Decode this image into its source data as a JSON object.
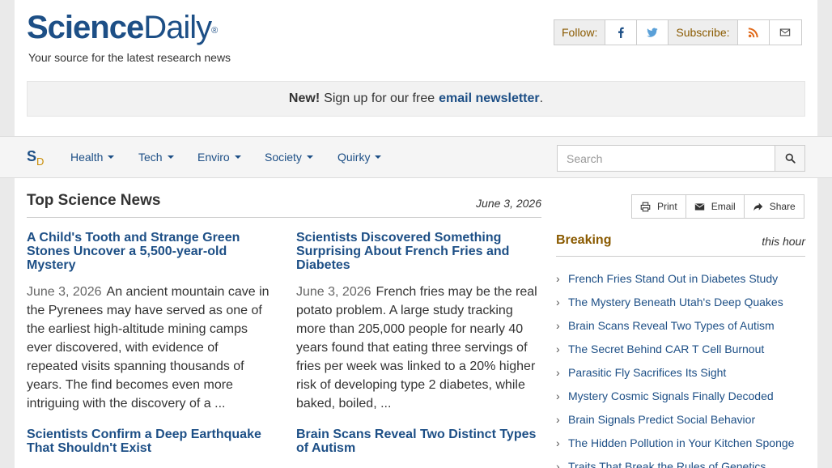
{
  "header": {
    "logo_bold": "Science",
    "logo_light": "Daily",
    "logo_mark": "®",
    "tagline": "Your source for the latest research news",
    "follow_label": "Follow:",
    "subscribe_label": "Subscribe:"
  },
  "newsletter": {
    "new_label": "New!",
    "text": "Sign up for our free",
    "link": "email newsletter",
    "end": "."
  },
  "nav": {
    "logo_s": "S",
    "logo_d": "D",
    "items": [
      "Health",
      "Tech",
      "Enviro",
      "Society",
      "Quirky"
    ],
    "search_placeholder": "Search"
  },
  "main": {
    "title": "Top Science News",
    "date": "June 3, 2026",
    "stories": [
      {
        "title": "A Child's Tooth and Strange Green Stones Uncover a 5,500-year-old Mystery",
        "date": "June 3, 2026",
        "summary": "An ancient mountain cave in the Pyrenees may have served as one of the earliest high-altitude mining camps ever discovered, with evidence of repeated visits spanning thousands of years. The find becomes even more intriguing with the discovery of a ..."
      },
      {
        "title": "Scientists Discovered Something Surprising About French Fries and Diabetes",
        "date": "June 3, 2026",
        "summary": "French fries may be the real potato problem. A large study tracking more than 205,000 people for nearly 40 years found that eating three servings of fries per week was linked to a 20% higher risk of developing type 2 diabetes, while baked, boiled, ..."
      },
      {
        "title": "Scientists Confirm a Deep Earthquake That Shouldn't Exist",
        "date": "",
        "summary": ""
      },
      {
        "title": "Brain Scans Reveal Two Distinct Types of Autism",
        "date": "",
        "summary": ""
      }
    ]
  },
  "sidebar": {
    "print_label": "Print",
    "email_label": "Email",
    "share_label": "Share",
    "breaking_title": "Breaking",
    "breaking_time": "this hour",
    "headlines": [
      "French Fries Stand Out in Diabetes Study",
      "The Mystery Beneath Utah's Deep Quakes",
      "Brain Scans Reveal Two Types of Autism",
      "The Secret Behind CAR T Cell Burnout",
      "Parasitic Fly Sacrifices Its Sight",
      "Mystery Cosmic Signals Finally Decoded",
      "Brain Signals Predict Social Behavior",
      "The Hidden Pollution in Your Kitchen Sponge",
      "Traits That Break the Rules of Genetics"
    ]
  },
  "colors": {
    "brand_blue": "#1d4f86",
    "accent_gold": "#8a5a00"
  }
}
